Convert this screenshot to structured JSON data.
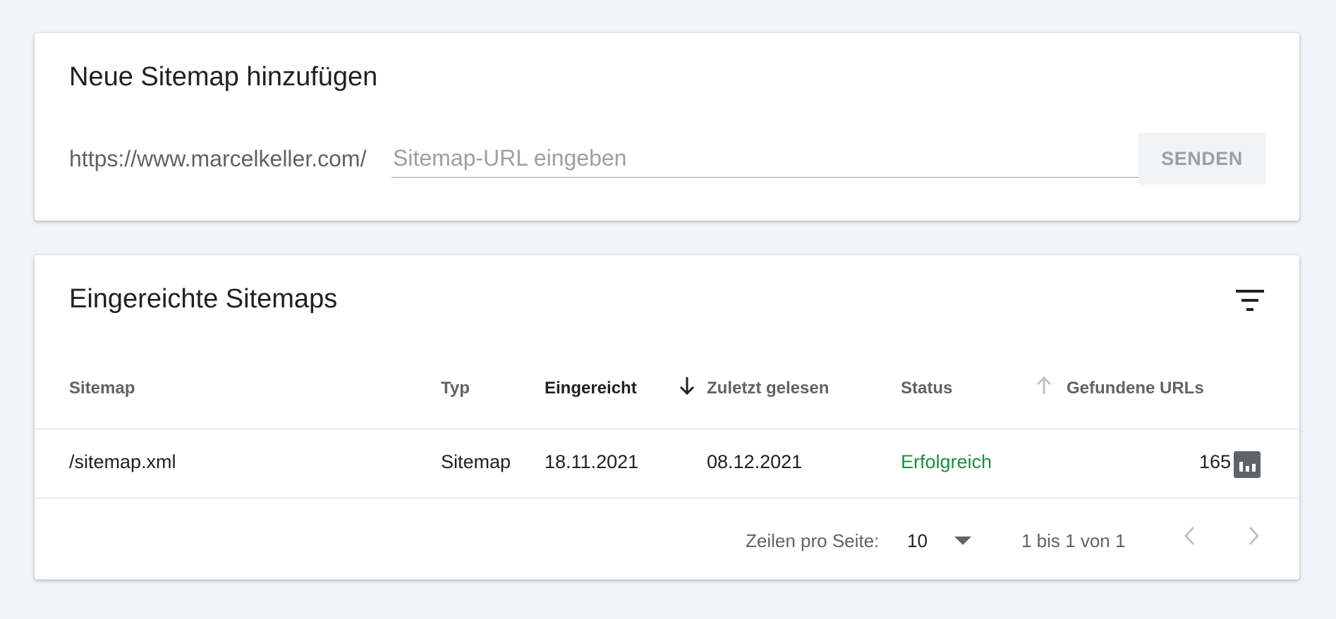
{
  "add_card": {
    "title": "Neue Sitemap hinzufügen",
    "url_prefix": "https://www.marcelkeller.com/",
    "input_placeholder": "Sitemap-URL eingeben",
    "input_value": "",
    "submit_label": "SENDEN"
  },
  "list_card": {
    "title": "Eingereichte Sitemaps",
    "filter_icon": "filter-icon",
    "columns": {
      "sitemap": "Sitemap",
      "type": "Typ",
      "submitted": "Eingereicht",
      "last_read": "Zuletzt gelesen",
      "status": "Status",
      "found_urls": "Gefundene URLs"
    },
    "sort": {
      "active_column": "submitted",
      "direction": "descending"
    },
    "rows": [
      {
        "sitemap": "/sitemap.xml",
        "type": "Sitemap",
        "submitted": "18.11.2021",
        "last_read": "08.12.2021",
        "status": "Erfolgreich",
        "found_urls": "165",
        "action_icon": "bar-chart-icon"
      }
    ],
    "pagination": {
      "rows_per_page_label": "Zeilen pro Seite:",
      "rows_per_page_value": "10",
      "range_text": "1 bis 1 von 1"
    }
  },
  "colors": {
    "background": "#f1f4f9",
    "status_success": "#1e8e3e",
    "icon_gray": "#5f6368"
  }
}
